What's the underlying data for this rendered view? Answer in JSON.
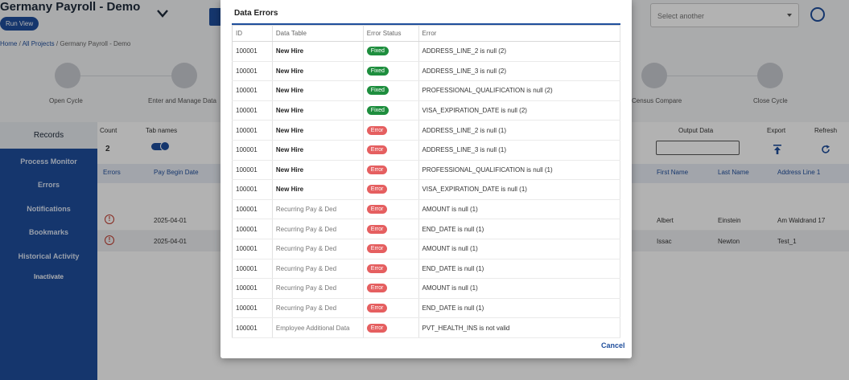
{
  "app": {
    "title": "Germany Payroll - Demo",
    "run_view": "Run View",
    "select_placeholder": "Select another"
  },
  "breadcrumb": {
    "home": "Home",
    "sep1": "/",
    "all_projects": "All Projects",
    "sep2": "/",
    "current": "Germany Payroll - Demo"
  },
  "stepper": [
    {
      "label": "Open Cycle",
      "icon": "open-icon"
    },
    {
      "label": "Enter and Manage Data",
      "icon": "user-icon"
    },
    {
      "label": "Census Compare",
      "icon": "compare-icon"
    },
    {
      "label": "Close Cycle",
      "icon": "close-icon"
    }
  ],
  "sidebar": {
    "records": "Records",
    "items": [
      "Process Monitor",
      "Errors",
      "Notifications",
      "Bookmarks",
      "Historical Activity",
      "Inactivate"
    ]
  },
  "toolbar": {
    "count_label": "Count",
    "count_value": "2",
    "tab_names": "Tab names",
    "output_data": "Output Data",
    "export": "Export",
    "refresh": "Refresh"
  },
  "grid": {
    "headers": {
      "errors": "Errors",
      "pay_begin_date": "Pay Begin Date",
      "first_name": "First Name",
      "last_name": "Last Name",
      "address_line_1": "Address Line 1"
    },
    "rows": [
      {
        "pay_begin_date": "2025-04-01",
        "first_name": "Albert",
        "last_name": "Einstein",
        "address": "Am Waldrand 17"
      },
      {
        "pay_begin_date": "2025-04-01",
        "first_name": "Issac",
        "last_name": "Newton",
        "address": "Test_1"
      }
    ]
  },
  "modal": {
    "title": "Data Errors",
    "columns": [
      "ID",
      "Data Table",
      "Error Status",
      "Error"
    ],
    "rows": [
      {
        "id": "100001",
        "table": "New Hire",
        "status": "Fixed",
        "error": "ADDRESS_LINE_2 is null (2)"
      },
      {
        "id": "100001",
        "table": "New Hire",
        "status": "Fixed",
        "error": "ADDRESS_LINE_3 is null (2)"
      },
      {
        "id": "100001",
        "table": "New Hire",
        "status": "Fixed",
        "error": "PROFESSIONAL_QUALIFICATION is null (2)"
      },
      {
        "id": "100001",
        "table": "New Hire",
        "status": "Fixed",
        "error": "VISA_EXPIRATION_DATE is null (2)"
      },
      {
        "id": "100001",
        "table": "New Hire",
        "status": "Error",
        "error": "ADDRESS_LINE_2 is null (1)"
      },
      {
        "id": "100001",
        "table": "New Hire",
        "status": "Error",
        "error": "ADDRESS_LINE_3 is null (1)"
      },
      {
        "id": "100001",
        "table": "New Hire",
        "status": "Error",
        "error": "PROFESSIONAL_QUALIFICATION is null (1)"
      },
      {
        "id": "100001",
        "table": "New Hire",
        "status": "Error",
        "error": "VISA_EXPIRATION_DATE is null (1)"
      },
      {
        "id": "100001",
        "table": "Recurring Pay & Ded",
        "status": "Error",
        "error": "AMOUNT is null (1)"
      },
      {
        "id": "100001",
        "table": "Recurring Pay & Ded",
        "status": "Error",
        "error": "END_DATE is null (1)"
      },
      {
        "id": "100001",
        "table": "Recurring Pay & Ded",
        "status": "Error",
        "error": "AMOUNT is null (1)"
      },
      {
        "id": "100001",
        "table": "Recurring Pay & Ded",
        "status": "Error",
        "error": "END_DATE is null (1)"
      },
      {
        "id": "100001",
        "table": "Recurring Pay & Ded",
        "status": "Error",
        "error": "AMOUNT is null (1)"
      },
      {
        "id": "100001",
        "table": "Recurring Pay & Ded",
        "status": "Error",
        "error": "END_DATE is null (1)"
      },
      {
        "id": "100001",
        "table": "Employee Additional Data",
        "status": "Error",
        "error": "PVT_HEALTH_INS is not valid"
      }
    ],
    "cancel": "Cancel"
  },
  "colors": {
    "primary": "#1f4e9c",
    "fixed": "#1e8e3e",
    "error": "#e55f60"
  }
}
